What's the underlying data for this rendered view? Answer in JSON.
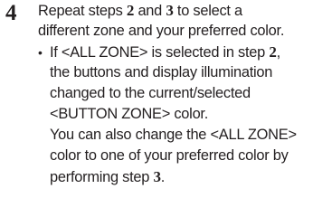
{
  "step": {
    "number": "4",
    "intro": {
      "l1_a": "Repeat steps ",
      "l1_b": "2",
      "l1_c": " and ",
      "l1_d": "3",
      "l1_e": " to select a",
      "l2": "different zone and your preferred color."
    },
    "bullet": {
      "marker": "•",
      "l1_a": "If <ALL ZONE> is selected in step ",
      "l1_b": "2",
      "l1_c": ",",
      "l2": "the buttons and display illumination",
      "l3": "changed to the current/selected",
      "l4": "<BUTTON ZONE> color.",
      "l5": "You can also change the <ALL ZONE>",
      "l6": "color to one of your preferred color by",
      "l7_a": "performing step ",
      "l7_b": "3",
      "l7_c": "."
    }
  }
}
